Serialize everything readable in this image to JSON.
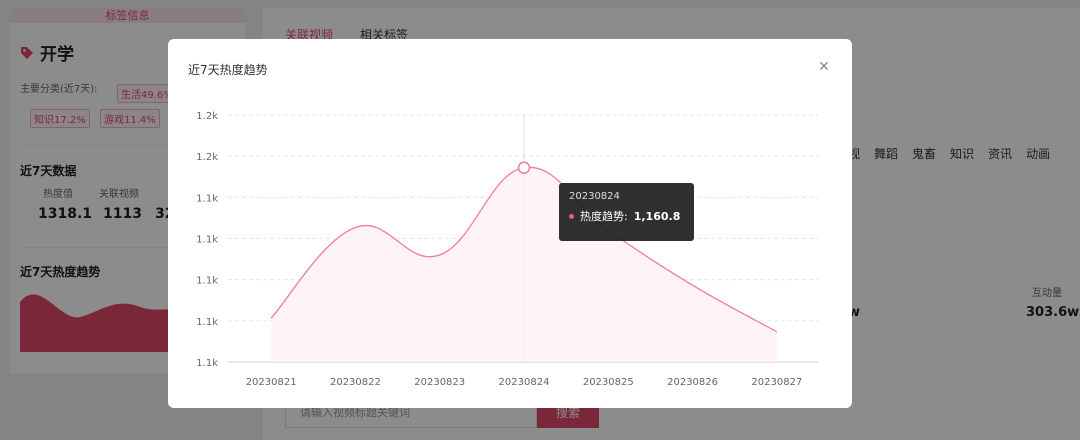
{
  "left_panel": {
    "header": "标签信息",
    "tag_name": "开学",
    "category_label": "主要分类(近7天):",
    "pills": [
      "生活49.6%",
      "知识17.2%",
      "游戏11.4%"
    ],
    "data_section_title": "近7天数据",
    "stats": [
      {
        "label": "热度值",
        "value": "1318.1"
      },
      {
        "label": "关联视频",
        "value": "1113"
      },
      {
        "label": "",
        "value": "32"
      }
    ],
    "trend_section_title": "近7天热度趋势"
  },
  "right_panel": {
    "tabs": [
      "关联视频",
      "相关标签"
    ],
    "categories": [
      "视",
      "舞蹈",
      "鬼畜",
      "知识",
      "资讯",
      "动画"
    ],
    "interaction_label": "互动量",
    "interaction_value": "303.6w",
    "partial_value": "w",
    "search_placeholder": "请输入视频标题关键词",
    "search_button": "搜索"
  },
  "modal": {
    "title": "近7天热度趋势",
    "close_icon": "close-icon"
  },
  "tooltip": {
    "date": "20230824",
    "series_label": "热度趋势:",
    "value": "1,160.8"
  },
  "colors": {
    "accent": "#e0476a",
    "line": "#f07ca0",
    "area": "#fdeef3"
  },
  "chart_data": {
    "type": "area",
    "x": [
      "20230821",
      "20230822",
      "20230823",
      "20230824",
      "20230825",
      "20230826",
      "20230827"
    ],
    "series": [
      {
        "name": "热度趋势",
        "values": [
          1106,
          1139,
          1129,
          1160.8,
          1138,
          1118,
          1101
        ]
      }
    ],
    "y_tick_labels": [
      "1.2k",
      "1.2k",
      "1.1k",
      "1.1k",
      "1.1k",
      "1.1k",
      "1.1k"
    ],
    "ylim": [
      1090,
      1180
    ],
    "highlight_index": 3,
    "grid": true
  }
}
